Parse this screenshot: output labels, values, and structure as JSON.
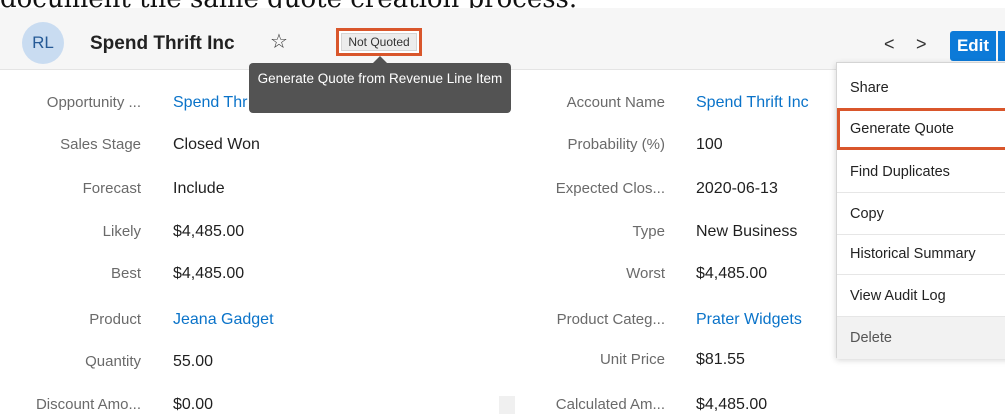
{
  "record": {
    "initials": "RL",
    "title": "Spend Thrift Inc",
    "favorite_icon": "star-outline-icon",
    "status_badge": "Not Quoted"
  },
  "nav": {
    "prev": "<",
    "next": ">"
  },
  "actions": {
    "edit_label": "Edit"
  },
  "tooltip": {
    "text": "Generate Quote from Revenue Line Item"
  },
  "fields": {
    "opportunity": {
      "label": "Opportunity ...",
      "value": "Spend Thr"
    },
    "account_name": {
      "label": "Account Name",
      "value": "Spend Thrift Inc"
    },
    "sales_stage": {
      "label": "Sales Stage",
      "value": "Closed Won"
    },
    "probability": {
      "label": "Probability (%)",
      "value": "100"
    },
    "forecast": {
      "label": "Forecast",
      "value": "Include"
    },
    "expected_close": {
      "label": "Expected Clos...",
      "value": "2020-06-13"
    },
    "likely": {
      "label": "Likely",
      "value": "$4,485.00"
    },
    "type": {
      "label": "Type",
      "value": "New Business"
    },
    "best": {
      "label": "Best",
      "value": "$4,485.00"
    },
    "worst": {
      "label": "Worst",
      "value": "$4,485.00"
    },
    "product": {
      "label": "Product",
      "value": "Jeana Gadget"
    },
    "product_category": {
      "label": "Product Categ...",
      "value": "Prater Widgets"
    },
    "quantity": {
      "label": "Quantity",
      "value": "55.00"
    },
    "unit_price": {
      "label": "Unit Price",
      "value": "$81.55"
    },
    "discount_amount": {
      "label": "Discount Amo...",
      "value": "$0.00"
    },
    "calculated_amount": {
      "label": "Calculated Am...",
      "value": "$4,485.00"
    }
  },
  "menu": {
    "share": "Share",
    "generate_quote": "Generate Quote",
    "find_duplicates": "Find Duplicates",
    "copy": "Copy",
    "historical_summary": "Historical Summary",
    "view_audit_log": "View Audit Log",
    "delete": "Delete"
  },
  "colors": {
    "accent": "#0c7ad8",
    "highlight": "#d9562b",
    "link": "#0a73c9"
  }
}
